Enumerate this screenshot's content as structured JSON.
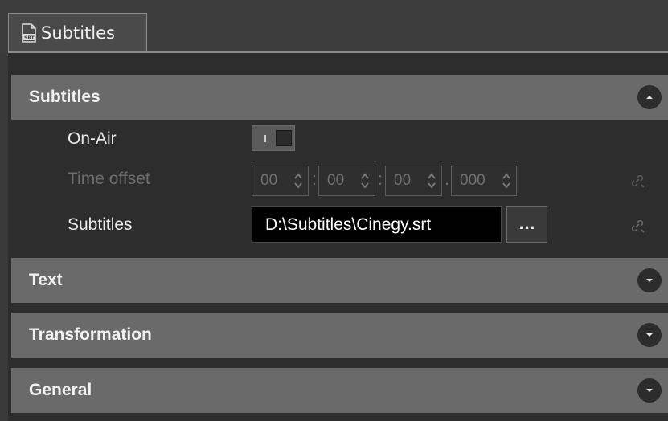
{
  "tab": {
    "label": "Subtitles",
    "icon": "subtitle-file-icon"
  },
  "sections": {
    "subtitles": {
      "title": "Subtitles",
      "expanded": true
    },
    "text": {
      "title": "Text",
      "expanded": false
    },
    "transformation": {
      "title": "Transformation",
      "expanded": false
    },
    "general": {
      "title": "General",
      "expanded": false
    }
  },
  "fields": {
    "on_air": {
      "label": "On-Air",
      "value": "off"
    },
    "time_offset": {
      "label": "Time offset",
      "hours": "00",
      "minutes": "00",
      "seconds": "00",
      "milliseconds": "000",
      "sep1": ":",
      "sep2": ":",
      "sep3": "."
    },
    "subtitles_file": {
      "label": "Subtitles",
      "value": "D:\\Subtitles\\Cinegy.srt",
      "browse_label": "..."
    }
  }
}
